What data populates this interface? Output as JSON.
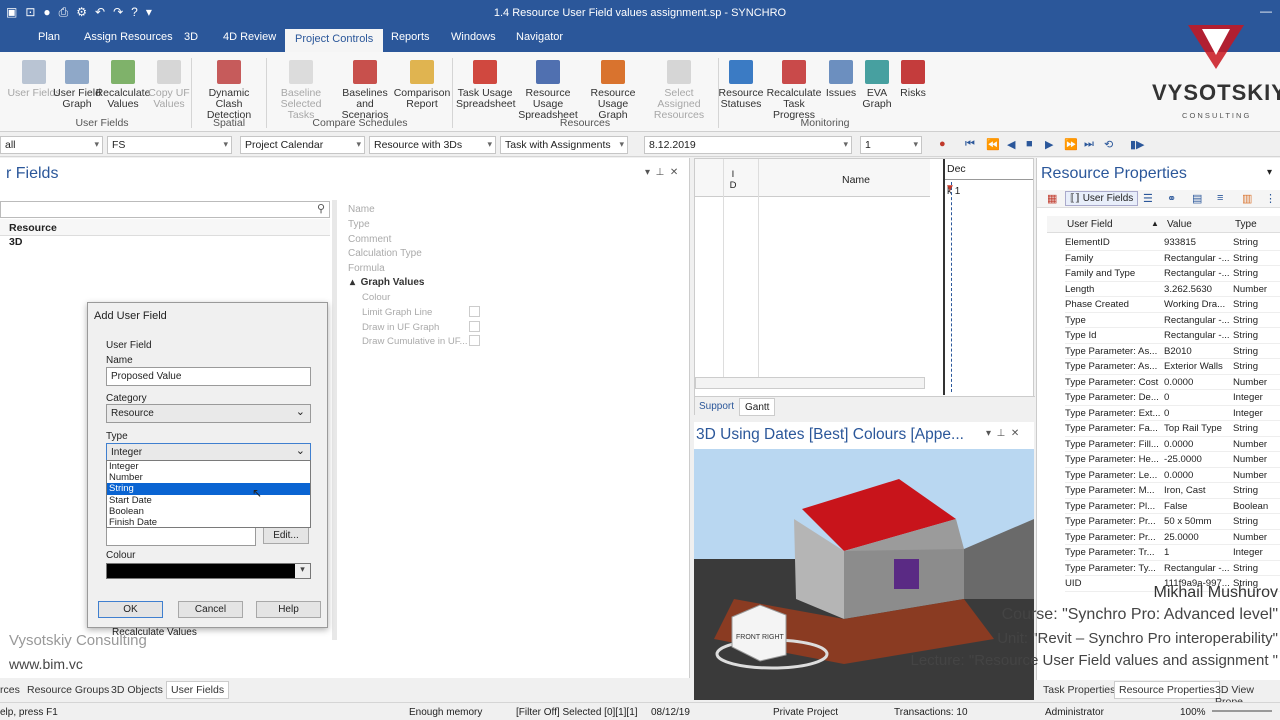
{
  "title": "1.4 Resource User Field values assignment.sp - SYNCHRO",
  "tabs": [
    "Plan",
    "Assign Resources",
    "3D",
    "4D Review",
    "Project Controls",
    "Reports",
    "Windows",
    "Navigator"
  ],
  "ribbon": {
    "buttons": [
      "User Fields",
      "User Field Graph",
      "Recalculate Values",
      "Copy UF Values",
      "Dynamic Clash Detection",
      "Baseline Selected Tasks",
      "Baselines and Scenarios",
      "Comparison Report",
      "Task Usage Spreadsheet",
      "Resource Usage Spreadsheet",
      "Resource Usage Graph",
      "Select Assigned Resources",
      "Resource Statuses",
      "Recalculate Task Progress",
      "Issues",
      "EVA Graph",
      "Risks"
    ],
    "groups": [
      "User Fields",
      "Spatial",
      "Compare Schedules",
      "Resources",
      "Monitoring"
    ]
  },
  "toolbar": {
    "d1": "all",
    "d2": "FS",
    "d3": "Project Calendar",
    "d4": "Resource with 3Ds",
    "d5": "Task with Assignments",
    "date": "8.12.2019",
    "num": "1"
  },
  "left": {
    "panel_title": "r Fields",
    "col": "Resource",
    "row": "3D",
    "props": [
      "Name",
      "Type",
      "Comment",
      "Calculation Type",
      "Formula"
    ],
    "graph_header": "Graph Values",
    "graph_props": [
      "Colour",
      "Limit Graph Line",
      "Draw in UF Graph",
      "Draw Cumulative in UF..."
    ]
  },
  "dialog": {
    "title": "Add User Field",
    "section": "User Field",
    "name_label": "Name",
    "name_value": "Proposed Value",
    "category_label": "Category",
    "category_value": "Resource",
    "type_label": "Type",
    "type_value": "Integer",
    "edit": "Edit...",
    "colour_label": "Colour",
    "ok": "OK",
    "cancel": "Cancel",
    "help": "Help",
    "options": [
      "Integer",
      "Number",
      "String",
      "Start Date",
      "Boolean",
      "Finish Date"
    ]
  },
  "recalc": "Recalculate Values",
  "gantt": {
    "col_id": "I D",
    "col_name": "Name",
    "month": "Dec",
    "week": "k 1",
    "tab_support": "Support",
    "tab_gantt": "Gantt"
  },
  "view3d": {
    "title": "3D Using Dates [Best] Colours [Appe...",
    "cube_front": "FRONT",
    "cube_right": "RIGHT"
  },
  "props": {
    "title": "Resource Properties",
    "tab": "User Fields",
    "headers": [
      "User Field",
      "Value",
      "Type"
    ],
    "rows": [
      [
        "ElementID",
        "933815",
        "String"
      ],
      [
        "Family",
        "Rectangular -...",
        "String"
      ],
      [
        "Family and Type",
        "Rectangular -...",
        "String"
      ],
      [
        "Length",
        "3.262.5630",
        "Number"
      ],
      [
        "Phase Created",
        "Working Dra...",
        "String"
      ],
      [
        "Type",
        "Rectangular -...",
        "String"
      ],
      [
        "Type Id",
        "Rectangular -...",
        "String"
      ],
      [
        "Type Parameter: As...",
        "B2010",
        "String"
      ],
      [
        "Type Parameter: As...",
        "Exterior Walls",
        "String"
      ],
      [
        "Type Parameter: Cost",
        "0.0000",
        "Number"
      ],
      [
        "Type Parameter: De...",
        "0",
        "Integer"
      ],
      [
        "Type Parameter: Ext...",
        "0",
        "Integer"
      ],
      [
        "Type Parameter: Fa...",
        "Top Rail Type",
        "String"
      ],
      [
        "Type Parameter: Fill...",
        "0.0000",
        "Number"
      ],
      [
        "Type Parameter: He...",
        "-25.0000",
        "Number"
      ],
      [
        "Type Parameter: Le...",
        "0.0000",
        "Number"
      ],
      [
        "Type Parameter: M...",
        "Iron, Cast",
        "String"
      ],
      [
        "Type Parameter: Pl...",
        "False",
        "Boolean"
      ],
      [
        "Type Parameter: Pr...",
        "50 x 50mm",
        "String"
      ],
      [
        "Type Parameter: Pr...",
        "25.0000",
        "Number"
      ],
      [
        "Type Parameter: Tr...",
        "1",
        "Integer"
      ],
      [
        "Type Parameter: Ty...",
        "Rectangular -...",
        "String"
      ],
      [
        "UID",
        "111f9a9a-997...",
        "String"
      ]
    ]
  },
  "bottom_tabs": [
    "rces",
    "Resource Groups",
    "3D Objects",
    "User Fields"
  ],
  "right_tabs": [
    "Task Properties",
    "Resource Properties",
    "3D View Prope"
  ],
  "status": [
    "elp, press F1",
    "Enough memory",
    "[Filter Off]  Selected [0][1][1]",
    "08/12/19",
    "Private Project",
    "Transactions: 10",
    "Administrator",
    "100%"
  ],
  "overlay": {
    "brand": "VYSOTSKIY",
    "brand_sub": "C O N S U L T I N G",
    "author": "Mikhail Mushurov",
    "course": "Course: \"Synchro Pro: Advanced level\"",
    "unit": "Unit: \"Revit – Synchro Pro interoperability\"",
    "lecture": "Lecture: \"Resource User Field values and assignment \"",
    "company": "Vysotskiy Consulting",
    "site": "www.bim.vc"
  }
}
